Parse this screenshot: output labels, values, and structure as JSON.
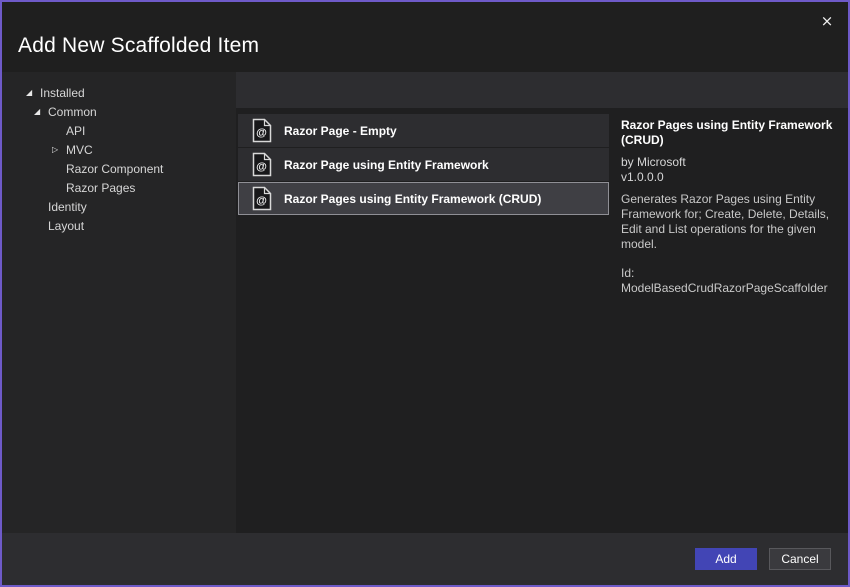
{
  "colors": {
    "dialog-border": "#6e5ac8",
    "dialog-bg": "#2d2d30",
    "titlebar-bg": "#1f1f1f",
    "sidebar-bg": "#252526",
    "panel-bg": "#1f1f20",
    "row-bg": "#2d2d30",
    "row-selected-bg": "#3f3f44",
    "row-selected-border": "#8f8f95",
    "add-button-bg": "#4245b5",
    "cancel-button-bg": "#3a3a3e",
    "cancel-button-border": "#58585c",
    "text-primary": "#ffffff",
    "text-secondary": "#d6d6d6"
  },
  "window": {
    "title": "Add New Scaffolded Item",
    "close_icon": "×"
  },
  "sidebar": {
    "items": [
      {
        "label": "Installed",
        "glyph": "◢",
        "level": 0,
        "state": "expanded"
      },
      {
        "label": "Common",
        "glyph": "◢",
        "level": 1,
        "state": "expanded"
      },
      {
        "label": "API",
        "glyph": "",
        "level": 2,
        "state": "none"
      },
      {
        "label": "MVC",
        "glyph": "▷",
        "level": 2,
        "state": "collapsed"
      },
      {
        "label": "Razor Component",
        "glyph": "",
        "level": 2,
        "state": "none"
      },
      {
        "label": "Razor Pages",
        "glyph": "",
        "level": 2,
        "state": "none"
      },
      {
        "label": "Identity",
        "glyph": "",
        "level": 1,
        "state": "none"
      },
      {
        "label": "Layout",
        "glyph": "",
        "level": 1,
        "state": "none"
      }
    ]
  },
  "list": {
    "items": [
      {
        "label": "Razor Page - Empty",
        "icon": "@",
        "selected": false
      },
      {
        "label": "Razor Page using Entity Framework",
        "icon": "@",
        "selected": false
      },
      {
        "label": "Razor Pages using Entity Framework (CRUD)",
        "icon": "@",
        "selected": true
      }
    ]
  },
  "details": {
    "title": "Razor Pages using Entity Framework (CRUD)",
    "author": "by Microsoft",
    "version": "v1.0.0.0",
    "description": "Generates Razor Pages using Entity Framework for; Create, Delete, Details, Edit and List operations for the given model.",
    "id": "Id: ModelBasedCrudRazorPageScaffolder"
  },
  "footer": {
    "add_label": "Add",
    "cancel_label": "Cancel"
  }
}
